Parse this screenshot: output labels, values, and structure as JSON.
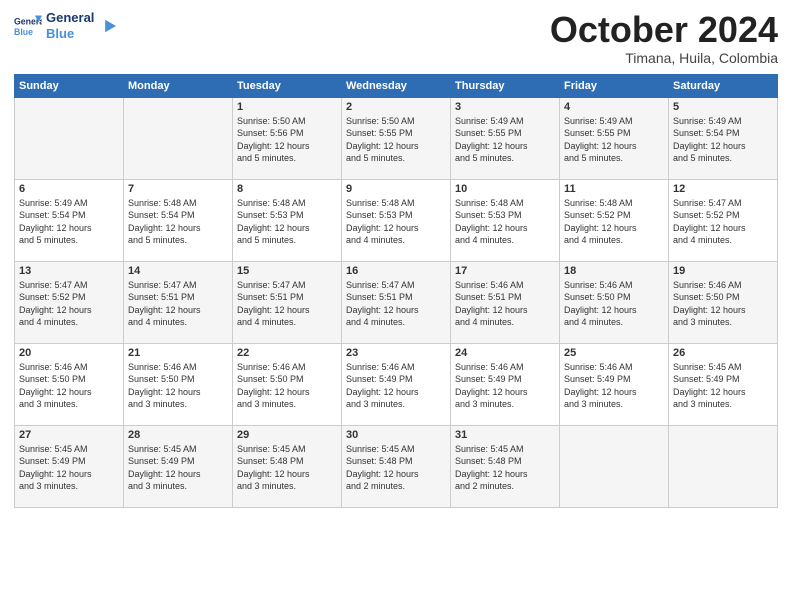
{
  "logo": {
    "line1": "General",
    "line2": "Blue"
  },
  "title": "October 2024",
  "subtitle": "Timana, Huila, Colombia",
  "days_of_week": [
    "Sunday",
    "Monday",
    "Tuesday",
    "Wednesday",
    "Thursday",
    "Friday",
    "Saturday"
  ],
  "weeks": [
    [
      {
        "day": "",
        "info": ""
      },
      {
        "day": "",
        "info": ""
      },
      {
        "day": "1",
        "info": "Sunrise: 5:50 AM\nSunset: 5:56 PM\nDaylight: 12 hours\nand 5 minutes."
      },
      {
        "day": "2",
        "info": "Sunrise: 5:50 AM\nSunset: 5:55 PM\nDaylight: 12 hours\nand 5 minutes."
      },
      {
        "day": "3",
        "info": "Sunrise: 5:49 AM\nSunset: 5:55 PM\nDaylight: 12 hours\nand 5 minutes."
      },
      {
        "day": "4",
        "info": "Sunrise: 5:49 AM\nSunset: 5:55 PM\nDaylight: 12 hours\nand 5 minutes."
      },
      {
        "day": "5",
        "info": "Sunrise: 5:49 AM\nSunset: 5:54 PM\nDaylight: 12 hours\nand 5 minutes."
      }
    ],
    [
      {
        "day": "6",
        "info": "Sunrise: 5:49 AM\nSunset: 5:54 PM\nDaylight: 12 hours\nand 5 minutes."
      },
      {
        "day": "7",
        "info": "Sunrise: 5:48 AM\nSunset: 5:54 PM\nDaylight: 12 hours\nand 5 minutes."
      },
      {
        "day": "8",
        "info": "Sunrise: 5:48 AM\nSunset: 5:53 PM\nDaylight: 12 hours\nand 5 minutes."
      },
      {
        "day": "9",
        "info": "Sunrise: 5:48 AM\nSunset: 5:53 PM\nDaylight: 12 hours\nand 4 minutes."
      },
      {
        "day": "10",
        "info": "Sunrise: 5:48 AM\nSunset: 5:53 PM\nDaylight: 12 hours\nand 4 minutes."
      },
      {
        "day": "11",
        "info": "Sunrise: 5:48 AM\nSunset: 5:52 PM\nDaylight: 12 hours\nand 4 minutes."
      },
      {
        "day": "12",
        "info": "Sunrise: 5:47 AM\nSunset: 5:52 PM\nDaylight: 12 hours\nand 4 minutes."
      }
    ],
    [
      {
        "day": "13",
        "info": "Sunrise: 5:47 AM\nSunset: 5:52 PM\nDaylight: 12 hours\nand 4 minutes."
      },
      {
        "day": "14",
        "info": "Sunrise: 5:47 AM\nSunset: 5:51 PM\nDaylight: 12 hours\nand 4 minutes."
      },
      {
        "day": "15",
        "info": "Sunrise: 5:47 AM\nSunset: 5:51 PM\nDaylight: 12 hours\nand 4 minutes."
      },
      {
        "day": "16",
        "info": "Sunrise: 5:47 AM\nSunset: 5:51 PM\nDaylight: 12 hours\nand 4 minutes."
      },
      {
        "day": "17",
        "info": "Sunrise: 5:46 AM\nSunset: 5:51 PM\nDaylight: 12 hours\nand 4 minutes."
      },
      {
        "day": "18",
        "info": "Sunrise: 5:46 AM\nSunset: 5:50 PM\nDaylight: 12 hours\nand 4 minutes."
      },
      {
        "day": "19",
        "info": "Sunrise: 5:46 AM\nSunset: 5:50 PM\nDaylight: 12 hours\nand 3 minutes."
      }
    ],
    [
      {
        "day": "20",
        "info": "Sunrise: 5:46 AM\nSunset: 5:50 PM\nDaylight: 12 hours\nand 3 minutes."
      },
      {
        "day": "21",
        "info": "Sunrise: 5:46 AM\nSunset: 5:50 PM\nDaylight: 12 hours\nand 3 minutes."
      },
      {
        "day": "22",
        "info": "Sunrise: 5:46 AM\nSunset: 5:50 PM\nDaylight: 12 hours\nand 3 minutes."
      },
      {
        "day": "23",
        "info": "Sunrise: 5:46 AM\nSunset: 5:49 PM\nDaylight: 12 hours\nand 3 minutes."
      },
      {
        "day": "24",
        "info": "Sunrise: 5:46 AM\nSunset: 5:49 PM\nDaylight: 12 hours\nand 3 minutes."
      },
      {
        "day": "25",
        "info": "Sunrise: 5:46 AM\nSunset: 5:49 PM\nDaylight: 12 hours\nand 3 minutes."
      },
      {
        "day": "26",
        "info": "Sunrise: 5:45 AM\nSunset: 5:49 PM\nDaylight: 12 hours\nand 3 minutes."
      }
    ],
    [
      {
        "day": "27",
        "info": "Sunrise: 5:45 AM\nSunset: 5:49 PM\nDaylight: 12 hours\nand 3 minutes."
      },
      {
        "day": "28",
        "info": "Sunrise: 5:45 AM\nSunset: 5:49 PM\nDaylight: 12 hours\nand 3 minutes."
      },
      {
        "day": "29",
        "info": "Sunrise: 5:45 AM\nSunset: 5:48 PM\nDaylight: 12 hours\nand 3 minutes."
      },
      {
        "day": "30",
        "info": "Sunrise: 5:45 AM\nSunset: 5:48 PM\nDaylight: 12 hours\nand 2 minutes."
      },
      {
        "day": "31",
        "info": "Sunrise: 5:45 AM\nSunset: 5:48 PM\nDaylight: 12 hours\nand 2 minutes."
      },
      {
        "day": "",
        "info": ""
      },
      {
        "day": "",
        "info": ""
      }
    ]
  ]
}
